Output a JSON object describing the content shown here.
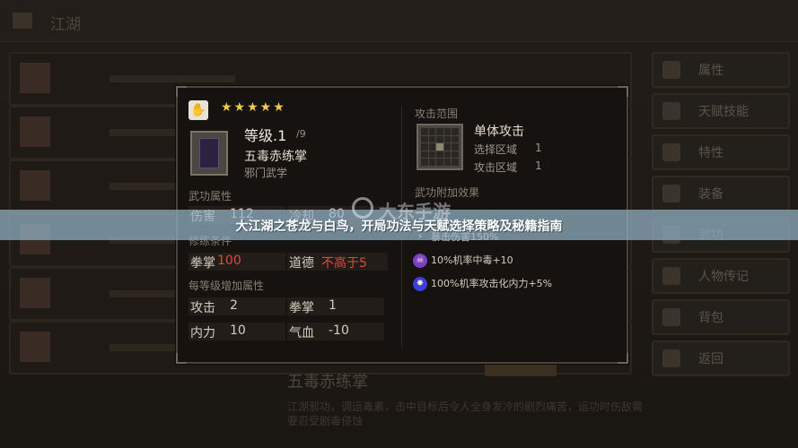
{
  "background": {
    "title": "江湖",
    "rows": 6,
    "sidebar": [
      "属性",
      "天赋技能",
      "特性",
      "装备",
      "武功",
      "人物传记",
      "背包",
      "返回"
    ],
    "desc_title": "五毒赤练掌",
    "desc_text": "江湖邪功，调运毒素，击中目标后令人全身发冷的剧烈痛苦，运功时伤敌需要忍受剧毒侵蚀"
  },
  "skill": {
    "type_icon": "palm-icon",
    "stars": "★★★★★",
    "level": "等级.1",
    "level_max": "/9",
    "name": "五毒赤练掌",
    "category": "邪门武学",
    "attr_title": "武功属性",
    "damage_label": "伤害",
    "damage_value": "112",
    "cooldown_label": "冷却",
    "cooldown_value": "80",
    "req_title": "修练条件",
    "req": [
      {
        "label": "拳掌",
        "value": "100"
      },
      {
        "label": "道德",
        "value": "不高于5"
      }
    ],
    "bonus_title": "每等级增加属性",
    "bonus": [
      {
        "label": "攻击",
        "value": "2"
      },
      {
        "label": "拳掌",
        "value": "1"
      },
      {
        "label": "内力",
        "value": "10"
      },
      {
        "label": "气血",
        "value": "-10"
      }
    ],
    "range_title_label": "攻击范围",
    "range_name": "单体攻击",
    "range_select_label": "选择区域",
    "range_select_value": "1",
    "range_attack_label": "攻击区域",
    "range_attack_value": "1",
    "effect_title": "武功附加效果",
    "effects": [
      {
        "icon": "lightning-icon",
        "text": "暴击伤害150%"
      },
      {
        "icon": "skull-icon",
        "text": "10%机率中毒+10"
      },
      {
        "icon": "burst-icon",
        "text": "100%机率攻击化内力+5%"
      }
    ]
  },
  "banner": {
    "text": "大江湖之苍龙与白鸟，开局功法与天赋选择策略及秘籍指南",
    "watermark": "大东手游"
  },
  "colors": {
    "accent_red": "#e04a3b",
    "star": "#f2c94c",
    "banner": "#96b4c8"
  }
}
